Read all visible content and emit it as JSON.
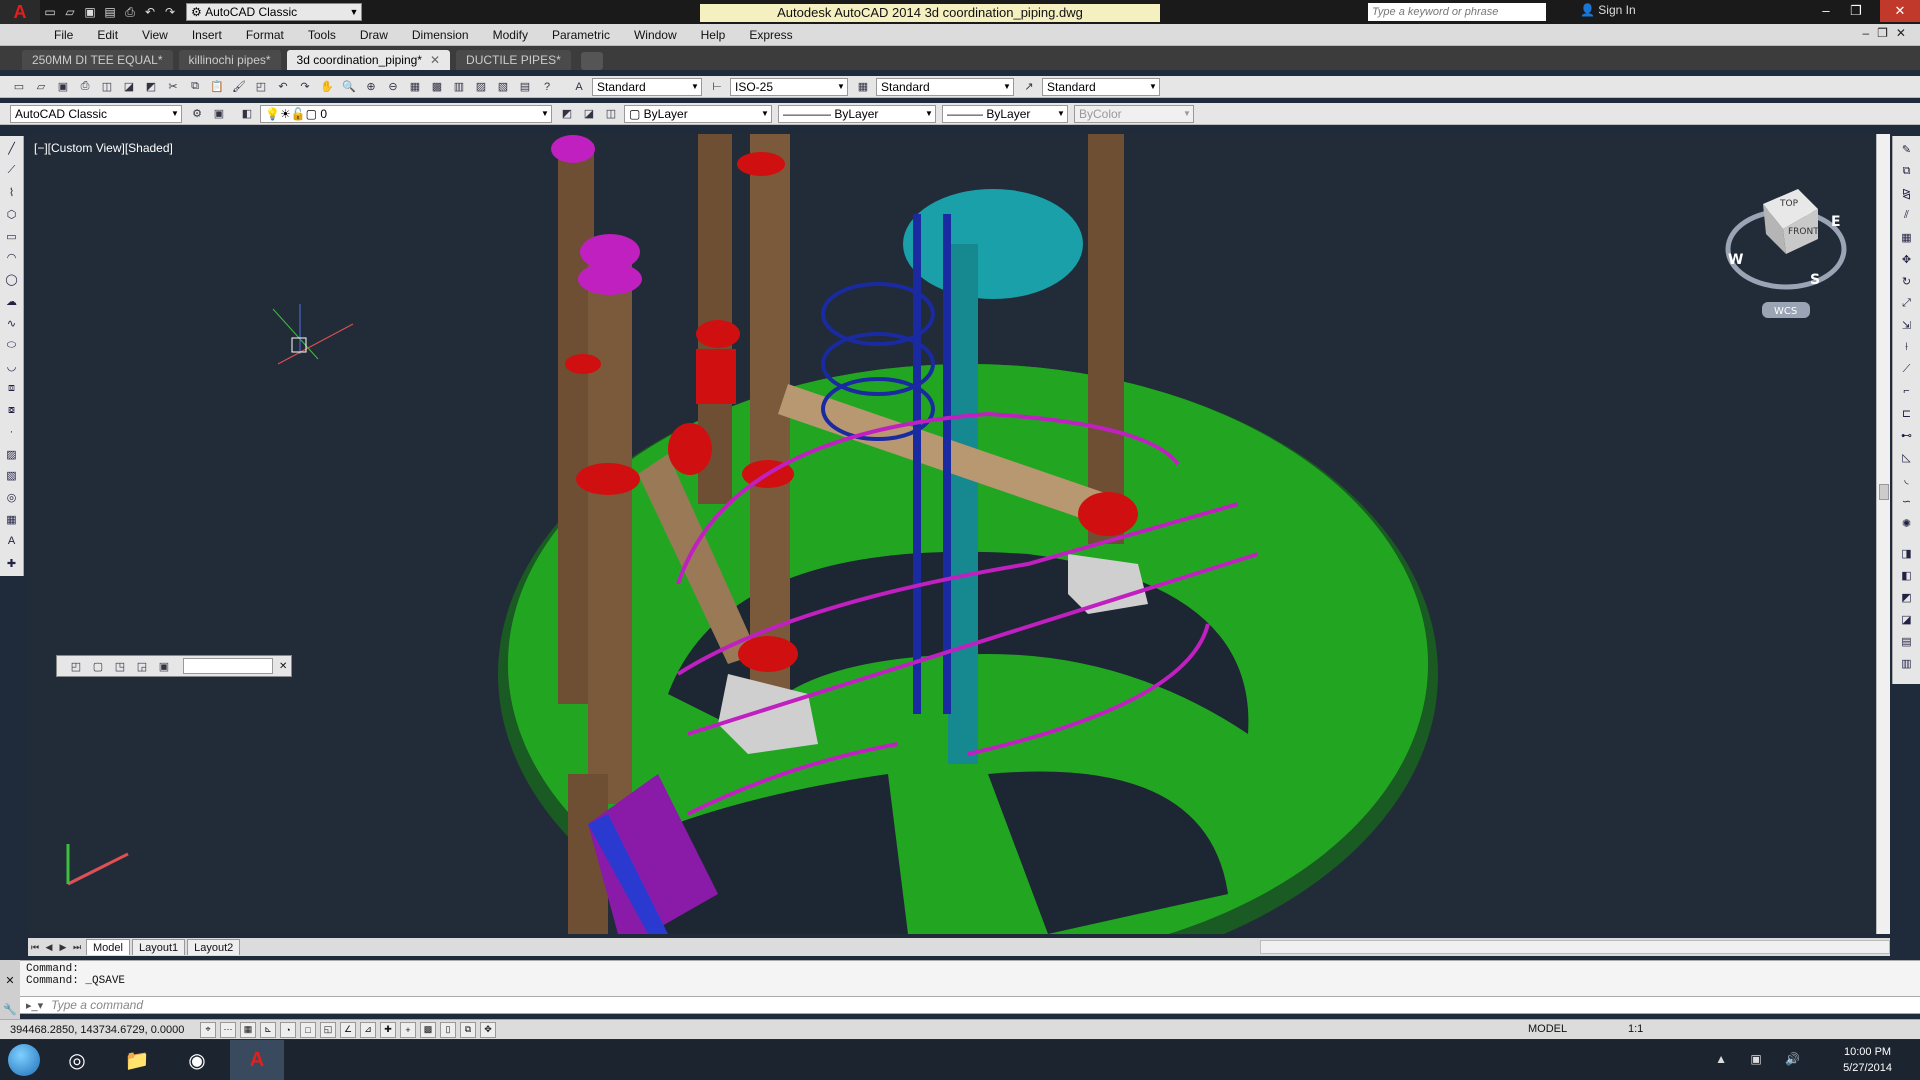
{
  "app": {
    "title": "Autodesk AutoCAD 2014   3d coordination_piping.dwg",
    "workspace": "AutoCAD Classic",
    "search_placeholder": "Type a keyword or phrase",
    "sign_in": "Sign In"
  },
  "menu": [
    "File",
    "Edit",
    "View",
    "Insert",
    "Format",
    "Tools",
    "Draw",
    "Dimension",
    "Modify",
    "Parametric",
    "Window",
    "Help",
    "Express"
  ],
  "tabs": [
    {
      "label": "250MM DI TEE EQUAL*",
      "active": false
    },
    {
      "label": "killinochi pipes*",
      "active": false
    },
    {
      "label": "3d coordination_piping*",
      "active": true
    },
    {
      "label": "DUCTILE PIPES*",
      "active": false
    }
  ],
  "toolbar1": {
    "text_style": "Standard",
    "dim_style": "ISO-25",
    "table_style": "Standard",
    "mleader_style": "Standard"
  },
  "toolbar2": {
    "workspace": "AutoCAD Classic",
    "layer": "0",
    "color": "ByLayer",
    "linetype": "ByLayer",
    "lineweight": "ByLayer",
    "plotstyle": "ByColor"
  },
  "viewport": {
    "label": "[−][Custom View][Shaded]",
    "viewcube": {
      "top": "TOP",
      "front": "FRONT",
      "w": "W",
      "e": "E",
      "s": "S",
      "wcs": "WCS"
    }
  },
  "layouts": [
    {
      "label": "Model",
      "active": true
    },
    {
      "label": "Layout1",
      "active": false
    },
    {
      "label": "Layout2",
      "active": false
    }
  ],
  "command": {
    "history": [
      "Command:",
      "Command:  _QSAVE"
    ],
    "placeholder": "Type a command"
  },
  "status": {
    "coords": "394468.2850, 143734.6729, 0.0000",
    "space": "MODEL",
    "scale": "1:1"
  },
  "clock": {
    "time": "10:00 PM",
    "date": "5/27/2014"
  },
  "colors": {
    "background": "#222b38",
    "platform": "#1f9a1f",
    "pipe": "#7a5a3a",
    "flange": "#d01010",
    "railing": "#c020c0",
    "ladder": "#1a2aa0",
    "tank": "#1aa0a8"
  }
}
